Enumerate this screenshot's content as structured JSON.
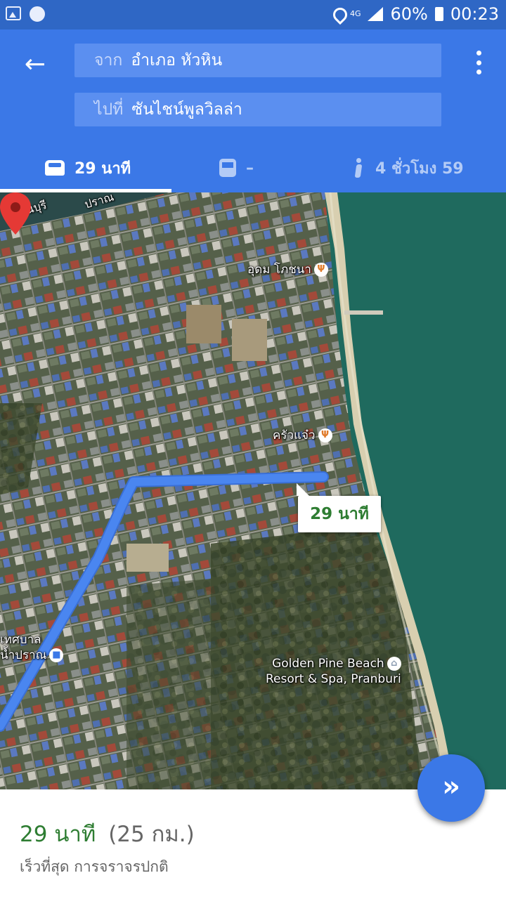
{
  "status_bar": {
    "icons": [
      "photo-icon",
      "line-app-icon",
      "location-icon",
      "signal-icon",
      "battery-icon"
    ],
    "network": "4G",
    "battery": "60%",
    "time": "00:23"
  },
  "header": {
    "from_prefix": "จาก",
    "from_value": "อำเภอ หัวหิน",
    "to_prefix": "ไปที่",
    "to_value": "ซันไชน์พูลวิลล่า",
    "modes": {
      "drive": "29 นาที",
      "transit": "–",
      "walk": "4 ชั่วโมง 59"
    }
  },
  "map": {
    "road_label_1": "ปราณบุรี",
    "road_label_2": "ปราณ",
    "poi_restaurant_1": "อุดม โภชนา",
    "poi_restaurant_2": "ครัวแจ๋ว",
    "poi_office_line1": "เทศบาล",
    "poi_office_line2": "น้ำปราณ",
    "hotel_line1": "Golden Pine Beach",
    "hotel_line2": "Resort & Spa, Pranburi",
    "route_callout": "29 นาที"
  },
  "sheet": {
    "duration": "29 นาที",
    "distance": "(25 กม.)",
    "description": "เร็วที่สุด การจราจรปกติ"
  },
  "colors": {
    "header_blue": "#3b78e7",
    "status_bar_blue": "#2f67c5",
    "route_blue": "#4a86f0",
    "duration_green": "#2e7d32",
    "pin_red": "#e53935"
  }
}
